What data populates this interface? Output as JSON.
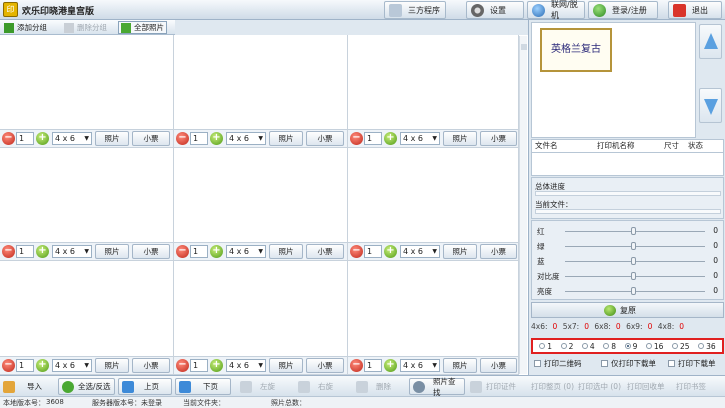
{
  "app": {
    "title": "欢乐印晓港皇宫版",
    "logo": "印"
  },
  "top_buttons": [
    {
      "label": "三方程序",
      "icon": "program-icon"
    },
    {
      "label": "设置",
      "icon": "gear-icon"
    },
    {
      "label": "联网/脱机",
      "icon": "network-icon"
    },
    {
      "label": "登录/注册",
      "icon": "login-icon"
    },
    {
      "label": "退出",
      "icon": "exit-icon"
    }
  ],
  "toolbar": {
    "add_group": "添加分组",
    "delete_group": "删除分组",
    "all_photos": "全部照片"
  },
  "cell": {
    "qty": "1",
    "size": "4 x 6",
    "photo_btn": "照片",
    "ticket_btn": "小票"
  },
  "preview": {
    "tile_text": "英格兰复古"
  },
  "print_table": {
    "headers": [
      "文件名",
      "打印机名称",
      "尺寸",
      "状态"
    ]
  },
  "progress": {
    "total_label": "总体进度",
    "current_label": "当前文件："
  },
  "adjust": {
    "rows": [
      {
        "label": "红",
        "value": "0"
      },
      {
        "label": "绿",
        "value": "0"
      },
      {
        "label": "蓝",
        "value": "0"
      },
      {
        "label": "对比度",
        "value": "0"
      },
      {
        "label": "亮度",
        "value": "0"
      }
    ],
    "reset_label": "复原"
  },
  "counts": [
    {
      "label": "4x6:",
      "value": "0"
    },
    {
      "label": "5x7:",
      "value": "0"
    },
    {
      "label": "6x8:",
      "value": "0"
    },
    {
      "label": "6x9:",
      "value": "0"
    },
    {
      "label": "4x8:",
      "value": "0"
    }
  ],
  "layouts": {
    "options": [
      "1",
      "2",
      "4",
      "8",
      "9",
      "16",
      "25",
      "36"
    ],
    "selected": "9"
  },
  "checks": [
    "打印二维码",
    "仅打印下载单",
    "打印下载单"
  ],
  "bottom": {
    "import": "导入",
    "select_all": "全选/反选",
    "prev": "上页",
    "next": "下页",
    "rotate_left": "左旋",
    "rotate_right": "右旋",
    "delete": "删除",
    "find": "照片查找",
    "print_cert": "打印证件",
    "print_page": "打印整页 (0)",
    "print_selected": "打印选中 (0)",
    "print_receipt": "打印回收单",
    "print_book": "打印书签"
  },
  "status": {
    "local_version": "本地版本号：",
    "local_version_value": "3608",
    "server_version": "服务器版本号：未登录",
    "current_folder": "当前文件夹：",
    "photo_total": "照片总数："
  },
  "colors": {
    "accent_red": "#e02020",
    "panel_bg": "#dfe8f0"
  }
}
